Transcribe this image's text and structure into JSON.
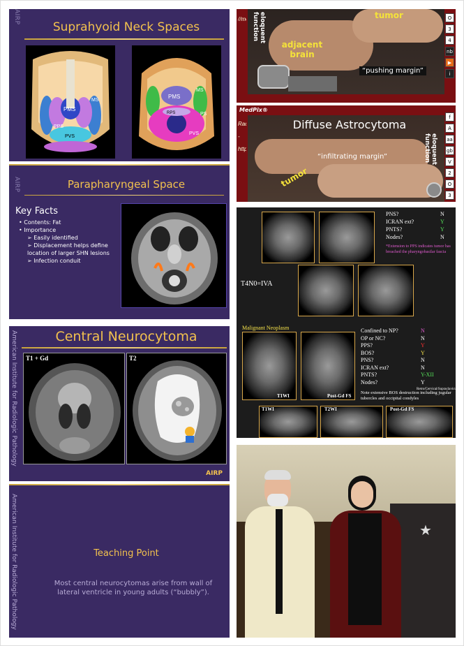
{
  "slides": {
    "suprahyoid": {
      "title": "Suprahyoid Neck Spaces",
      "logo": "AIRP",
      "left_labels": [
        "PMS",
        "MS",
        "PPS",
        "PS",
        "RPS",
        "PVS"
      ],
      "right_labels": [
        "PMS",
        "MS",
        "PS",
        "RPS",
        "PVS"
      ]
    },
    "parapharyngeal": {
      "title": "Parapharyngeal Space",
      "logo": "AIRP",
      "key_facts_heading": "Key Facts",
      "bullets": [
        "Contents: Fat",
        "Importance"
      ],
      "sub_bullets": [
        "Easily identified",
        "Displacement helps define location of larger SHN lesions",
        "Infection conduit"
      ]
    },
    "neurocytoma": {
      "title": "Central Neurocytoma",
      "side_text": "American Institute for Radiologic Pathology",
      "panel_left_label": "T1 + Gd",
      "panel_right_label": "T2",
      "logo": "AIRP"
    },
    "teaching": {
      "side_text": "American Institute for Radiologic Pathology",
      "heading": "Teaching Point",
      "body": "Most central neurocytomas arise from wall of lateral ventricle in young adults (“bubbly”)."
    }
  },
  "medpix": {
    "top": {
      "side_text": "//medpix.nlm.nih.gov",
      "eloquent": "eloquent function",
      "tumor": "tumor",
      "adjacent": "adjacent brain",
      "caption": "“pushing margin”",
      "buttons": [
        "3",
        "4",
        "nb",
        "▶",
        "i"
      ],
      "button_top_partial": "O"
    },
    "bottom": {
      "brand": "MedPix®",
      "side_text": "Radiology - http://med",
      "title": "Diffuse Astrocytoma",
      "caption": "“infiltrating margin”",
      "eloquent": "eloquent function",
      "tumor": "tumor",
      "buttons": [
        "f",
        "A",
        "aa",
        "gb",
        "V",
        "2",
        "O",
        "3"
      ]
    }
  },
  "staging": {
    "top_checklist": [
      {
        "q": "PNS?",
        "a": "N",
        "color": "white"
      },
      {
        "q": "ICRAN ext?",
        "a": "Y",
        "color": "green"
      },
      {
        "q": "PNTS?",
        "a": "Y",
        "color": "green"
      },
      {
        "q": "Nodes?",
        "a": "N",
        "color": "white"
      }
    ],
    "note_top": "*Extension to PPS indicates tumor has breached the pharyngobasilar fascia",
    "stage": "T4N0=IVA",
    "section_title": "Malignant Neoplasm",
    "bottom_checklist": [
      {
        "q": "Confined to NP?",
        "a": "N",
        "color": "purple"
      },
      {
        "q": "OP or NC?",
        "a": "N",
        "color": "white"
      },
      {
        "q": "PPS?",
        "a": "Y",
        "color": "red"
      },
      {
        "q": "BOS?",
        "a": "Y",
        "color": "yellow"
      },
      {
        "q": "PNS?",
        "a": "N",
        "color": "white"
      },
      {
        "q": "ICRAN ext?",
        "a": "N",
        "color": "white"
      },
      {
        "q": "PNTS?",
        "a": "Y-XII",
        "color": "green"
      },
      {
        "q": "Nodes?",
        "a": "Y",
        "color": "white"
      }
    ],
    "nodes_note": "Retro/Cervical/Supraclavicular",
    "note_bottom": "Note extensive BOS destruction including jugular tubercles and occipital condyles",
    "labels_mid": [
      "T1WI",
      "Post-Gd FS"
    ],
    "labels_bottom": [
      "T1WI",
      "T2WI",
      "Post-Gd FS"
    ]
  },
  "colors": {
    "slide_bg": "#3a2a63",
    "gold": "#f2c14e",
    "medpix_red": "#7a0f12"
  }
}
